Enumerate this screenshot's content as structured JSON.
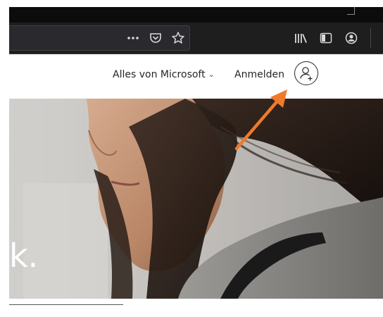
{
  "browser": {
    "toolbar_icons": {
      "more": "more-actions-icon",
      "pocket": "pocket-icon",
      "bookmark": "bookmark-star-icon",
      "library": "library-icon",
      "sidebar": "sidebar-icon",
      "account": "account-icon"
    }
  },
  "header": {
    "all_microsoft": "Alles von Microsoft",
    "sign_in": "Anmelden"
  },
  "hero": {
    "partial_text": "k."
  },
  "annotation": {
    "color": "#f07a2a"
  }
}
